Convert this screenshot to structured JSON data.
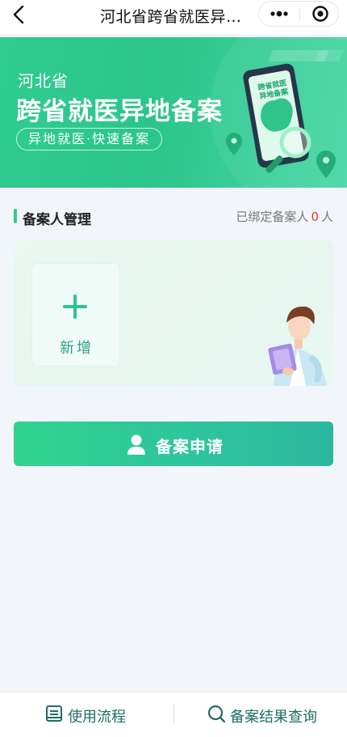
{
  "nav": {
    "title": "河北省跨省就医异…",
    "back_icon": "chevron-left-icon",
    "more_icon": "more-dots-icon",
    "close_icon": "target-circle-icon"
  },
  "banner": {
    "subtitle": "河北省",
    "title": "跨省就医异地备案",
    "tagline": "异地就医·快速备案",
    "phone_text": "跨省就医异地备案"
  },
  "section": {
    "title": "备案人管理",
    "bound_prefix": "已绑定备案人",
    "bound_count": "0",
    "bound_suffix": "人"
  },
  "card": {
    "add_label": "新增",
    "add_icon": "plus-icon"
  },
  "apply": {
    "label": "备案申请",
    "icon": "person-icon"
  },
  "bottom": {
    "process_label": "使用流程",
    "process_icon": "process-list-icon",
    "query_label": "备案结果查询",
    "query_icon": "search-icon"
  },
  "colors": {
    "primary_green": "#2ccf90",
    "count_red": "#e63a2e",
    "bottom_text": "#1e6e64"
  }
}
